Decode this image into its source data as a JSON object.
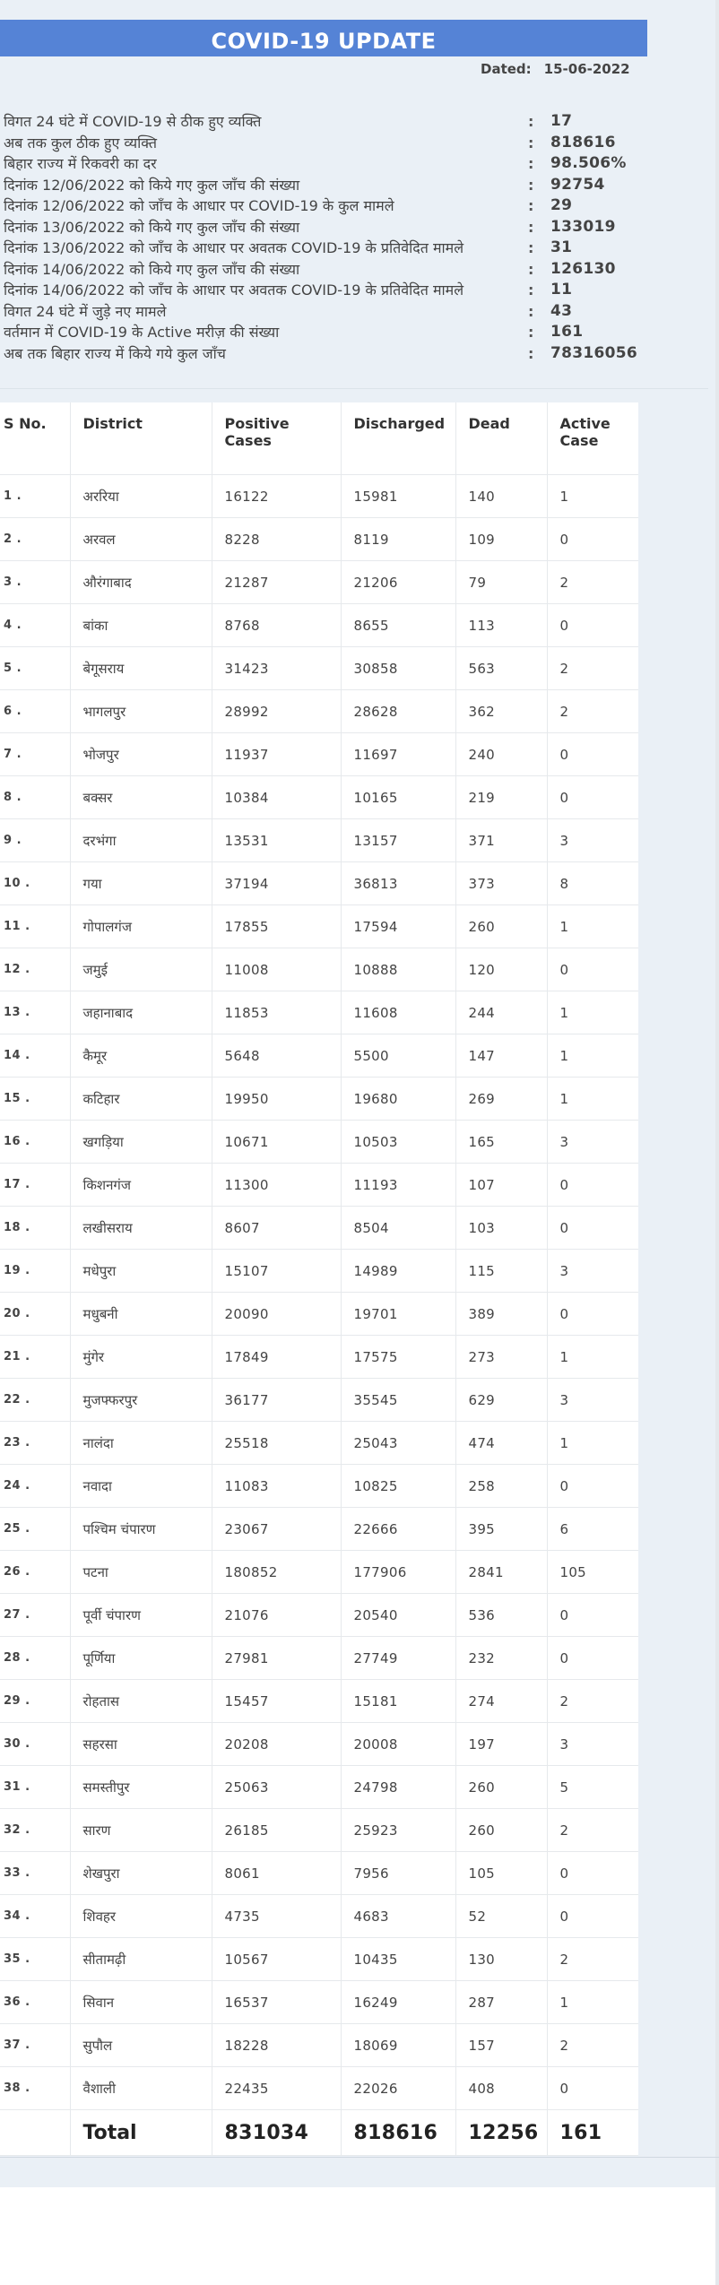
{
  "header": {
    "title": "COVID-19 UPDATE",
    "dated_label": "Dated:",
    "dated_value": "15-06-2022"
  },
  "summary": [
    {
      "label": "विगत 24 घंटे में COVID-19 से ठीक हुए व्यक्ति",
      "value": "17"
    },
    {
      "label": "अब तक कुल ठीक हुए व्यक्ति",
      "value": "818616"
    },
    {
      "label": "बिहार राज्य में रिकवरी का दर",
      "value": "98.506%"
    },
    {
      "label": "दिनांक 12/06/2022 को किये गए कुल जाँच की संख्या",
      "value": "92754"
    },
    {
      "label": "दिनांक 12/06/2022 को जाँच के आधार पर COVID-19 के कुल मामले",
      "value": "29"
    },
    {
      "label": "दिनांक 13/06/2022 को किये गए कुल जाँच की संख्या",
      "value": "133019"
    },
    {
      "label": "दिनांक 13/06/2022 को जाँच के आधार पर अवतक COVID-19 के प्रतिवेदित मामले",
      "value": "31"
    },
    {
      "label": "दिनांक 14/06/2022 को किये गए कुल जाँच की संख्या",
      "value": "126130"
    },
    {
      "label": "दिनांक 14/06/2022 को जाँच के आधार पर अवतक COVID-19 के प्रतिवेदित मामले",
      "value": "11"
    },
    {
      "label": "विगत 24 घंटे में जुड़े नए मामले",
      "value": "43"
    },
    {
      "label": "वर्तमान में COVID-19 के Active मरीज़ की संख्या",
      "value": "161"
    },
    {
      "label": "अब तक बिहार राज्य में किये गये कुल जाँच",
      "value": "78316056"
    }
  ],
  "summary_colon": ":",
  "table": {
    "headers": [
      "S No.",
      "District",
      "Positive Cases",
      "Discharged",
      "Dead",
      "Active Case"
    ],
    "rows": [
      [
        "1 .",
        "अररिया",
        "16122",
        "15981",
        "140",
        "1"
      ],
      [
        "2 .",
        "अरवल",
        "8228",
        "8119",
        "109",
        "0"
      ],
      [
        "3 .",
        "औरंगाबाद",
        "21287",
        "21206",
        "79",
        "2"
      ],
      [
        "4 .",
        "बांका",
        "8768",
        "8655",
        "113",
        "0"
      ],
      [
        "5 .",
        "बेगूसराय",
        "31423",
        "30858",
        "563",
        "2"
      ],
      [
        "6 .",
        "भागलपुर",
        "28992",
        "28628",
        "362",
        "2"
      ],
      [
        "7 .",
        "भोजपुर",
        "11937",
        "11697",
        "240",
        "0"
      ],
      [
        "8 .",
        "बक्सर",
        "10384",
        "10165",
        "219",
        "0"
      ],
      [
        "9 .",
        "दरभंगा",
        "13531",
        "13157",
        "371",
        "3"
      ],
      [
        "10 .",
        "गया",
        "37194",
        "36813",
        "373",
        "8"
      ],
      [
        "11 .",
        "गोपालगंज",
        "17855",
        "17594",
        "260",
        "1"
      ],
      [
        "12 .",
        "जमुई",
        "11008",
        "10888",
        "120",
        "0"
      ],
      [
        "13 .",
        "जहानाबाद",
        "11853",
        "11608",
        "244",
        "1"
      ],
      [
        "14 .",
        "कैमूर",
        "5648",
        "5500",
        "147",
        "1"
      ],
      [
        "15 .",
        "कटिहार",
        "19950",
        "19680",
        "269",
        "1"
      ],
      [
        "16 .",
        "खगड़िया",
        "10671",
        "10503",
        "165",
        "3"
      ],
      [
        "17 .",
        "किशनगंज",
        "11300",
        "11193",
        "107",
        "0"
      ],
      [
        "18 .",
        "लखीसराय",
        "8607",
        "8504",
        "103",
        "0"
      ],
      [
        "19 .",
        "मधेपुरा",
        "15107",
        "14989",
        "115",
        "3"
      ],
      [
        "20 .",
        "मधुबनी",
        "20090",
        "19701",
        "389",
        "0"
      ],
      [
        "21 .",
        "मुंगेर",
        "17849",
        "17575",
        "273",
        "1"
      ],
      [
        "22 .",
        "मुजफ्फरपुर",
        "36177",
        "35545",
        "629",
        "3"
      ],
      [
        "23 .",
        "नालंदा",
        "25518",
        "25043",
        "474",
        "1"
      ],
      [
        "24 .",
        "नवादा",
        "11083",
        "10825",
        "258",
        "0"
      ],
      [
        "25 .",
        "पश्चिम चंपारण",
        "23067",
        "22666",
        "395",
        "6"
      ],
      [
        "26 .",
        "पटना",
        "180852",
        "177906",
        "2841",
        "105"
      ],
      [
        "27 .",
        "पूर्वी चंपारण",
        "21076",
        "20540",
        "536",
        "0"
      ],
      [
        "28 .",
        "पूर्णिया",
        "27981",
        "27749",
        "232",
        "0"
      ],
      [
        "29 .",
        "रोहतास",
        "15457",
        "15181",
        "274",
        "2"
      ],
      [
        "30 .",
        "सहरसा",
        "20208",
        "20008",
        "197",
        "3"
      ],
      [
        "31 .",
        "समस्तीपुर",
        "25063",
        "24798",
        "260",
        "5"
      ],
      [
        "32 .",
        "सारण",
        "26185",
        "25923",
        "260",
        "2"
      ],
      [
        "33 .",
        "शेखपुरा",
        "8061",
        "7956",
        "105",
        "0"
      ],
      [
        "34 .",
        "शिवहर",
        "4735",
        "4683",
        "52",
        "0"
      ],
      [
        "35 .",
        "सीतामढ़ी",
        "10567",
        "10435",
        "130",
        "2"
      ],
      [
        "36 .",
        "सिवान",
        "16537",
        "16249",
        "287",
        "1"
      ],
      [
        "37 .",
        "सुपौल",
        "18228",
        "18069",
        "157",
        "2"
      ],
      [
        "38 .",
        "वैशाली",
        "22435",
        "22026",
        "408",
        "0"
      ]
    ],
    "total": [
      "",
      "Total",
      "831034",
      "818616",
      "12256",
      "161"
    ]
  }
}
